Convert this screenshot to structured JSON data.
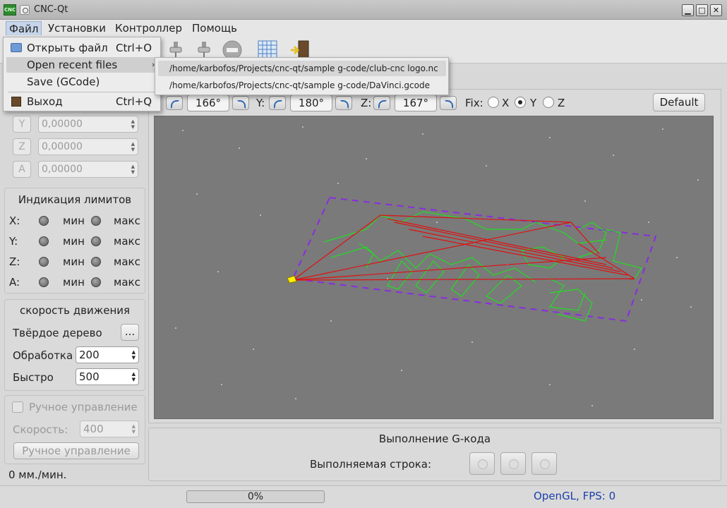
{
  "window": {
    "title": "CNC-Qt",
    "app_icon_text": "CNC"
  },
  "menubar": [
    "Файл",
    "Установки",
    "Контроллер",
    "Помощь"
  ],
  "file_menu": {
    "open_file": "Открыть файл",
    "open_file_shortcut": "Ctrl+O",
    "open_recent": "Open recent files",
    "save_gcode": "Save (GCode)",
    "exit": "Выход",
    "exit_shortcut": "Ctrl+Q"
  },
  "recent_files": [
    "/home/karbofos/Projects/cnc-qt/sample g-code/club-cnc logo.nc",
    "/home/karbofos/Projects/cnc-qt/sample g-code/DaVinci.gcode"
  ],
  "coords": [
    {
      "axis": "Y",
      "value": "0,00000"
    },
    {
      "axis": "Z",
      "value": "0,00000"
    },
    {
      "axis": "A",
      "value": "0,00000"
    }
  ],
  "limits": {
    "title": "Индикация лимитов",
    "rows": [
      {
        "axis": "X:",
        "min": "мин",
        "max": "макс"
      },
      {
        "axis": "Y:",
        "min": "мин",
        "max": "макс"
      },
      {
        "axis": "Z:",
        "min": "мин",
        "max": "макс"
      },
      {
        "axis": "A:",
        "min": "мин",
        "max": "макс"
      }
    ]
  },
  "speed": {
    "title": "скорость движения",
    "material": "Твёрдое дерево",
    "material_btn": "...",
    "processing_label": "Обработка",
    "processing_value": "200",
    "fast_label": "Быстро",
    "fast_value": "500"
  },
  "manual": {
    "checkbox_label": "Ручное управление",
    "speed_label": "Скорость:",
    "speed_value": "400",
    "button_label": "Ручное управление"
  },
  "feed_status": "0 мм./мин.",
  "view": {
    "x_angle": "166°",
    "y_label": "Y:",
    "y_angle": "180°",
    "z_label": "Z:",
    "z_angle": "167°",
    "fix_label": "Fix:",
    "fix_x": "X",
    "fix_y": "Y",
    "fix_z": "Z",
    "fix_selected": "Y",
    "default_btn": "Default"
  },
  "execution": {
    "title": "Выполнение G-кода",
    "line_label": "Выполняемая строка:"
  },
  "status": {
    "progress": "0%",
    "progress_fraction": 0,
    "fps": "OpenGL, FPS: 0",
    "fps_color": "#1c3faa"
  }
}
